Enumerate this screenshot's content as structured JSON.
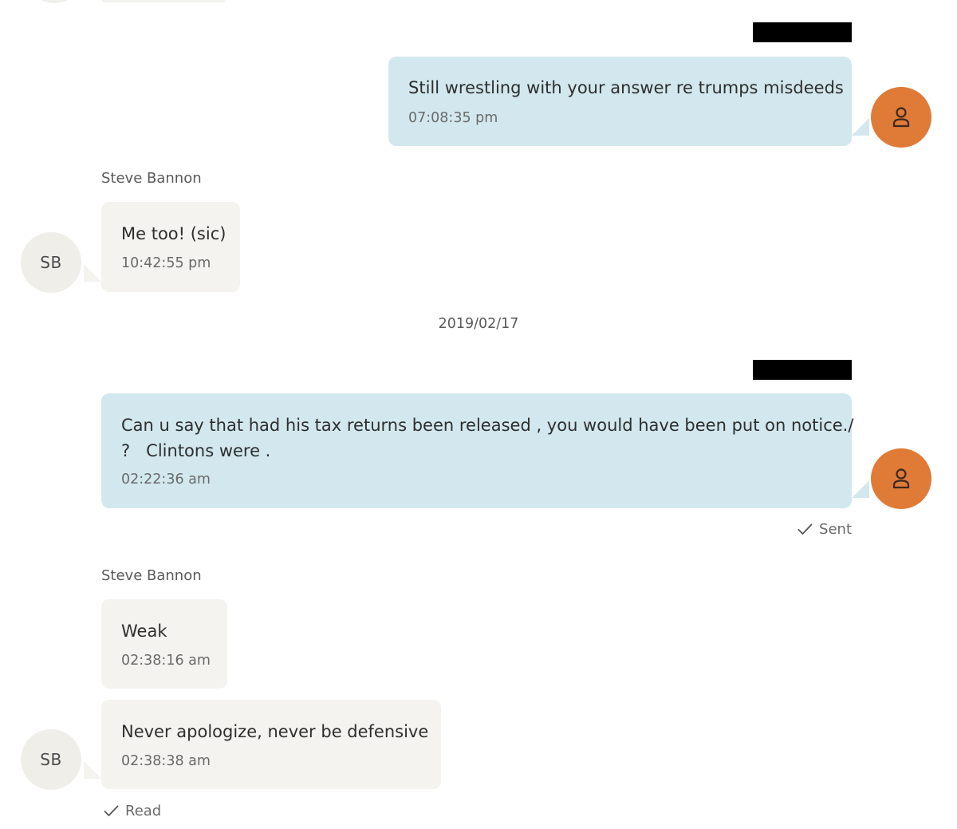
{
  "conversation": {
    "messages": [
      {
        "direction": "outgoing",
        "text": "Still wrestling with your answer re trumps misdeeds",
        "time": "07:08:35 pm"
      },
      {
        "direction": "incoming",
        "sender": "Steve Bannon",
        "avatar_initials": "SB",
        "text": "Me too! (sic)",
        "time": "10:42:55 pm"
      },
      {
        "direction": "outgoing",
        "text_lines": [
          "Can u say that had his tax returns been released , you would have been put on notice./",
          "?   Clintons were ."
        ],
        "time": "02:22:36 am",
        "status": "Sent"
      },
      {
        "direction": "incoming",
        "sender": "Steve Bannon",
        "text": "Weak",
        "time": "02:38:16 am"
      },
      {
        "direction": "incoming",
        "avatar_initials": "SB",
        "text": "Never apologize, never be defensive",
        "time": "02:38:38 am",
        "status": "Read"
      }
    ],
    "date_separator": "2019/02/17"
  },
  "colors": {
    "outgoing_bubble": "#d2e8ee",
    "incoming_bubble": "#f4f3f0",
    "my_avatar": "#e07a37",
    "contact_avatar": "#efeee9",
    "redaction": "#000000"
  },
  "icons": {
    "my_avatar": "user-icon",
    "status": "checkmark-icon"
  }
}
